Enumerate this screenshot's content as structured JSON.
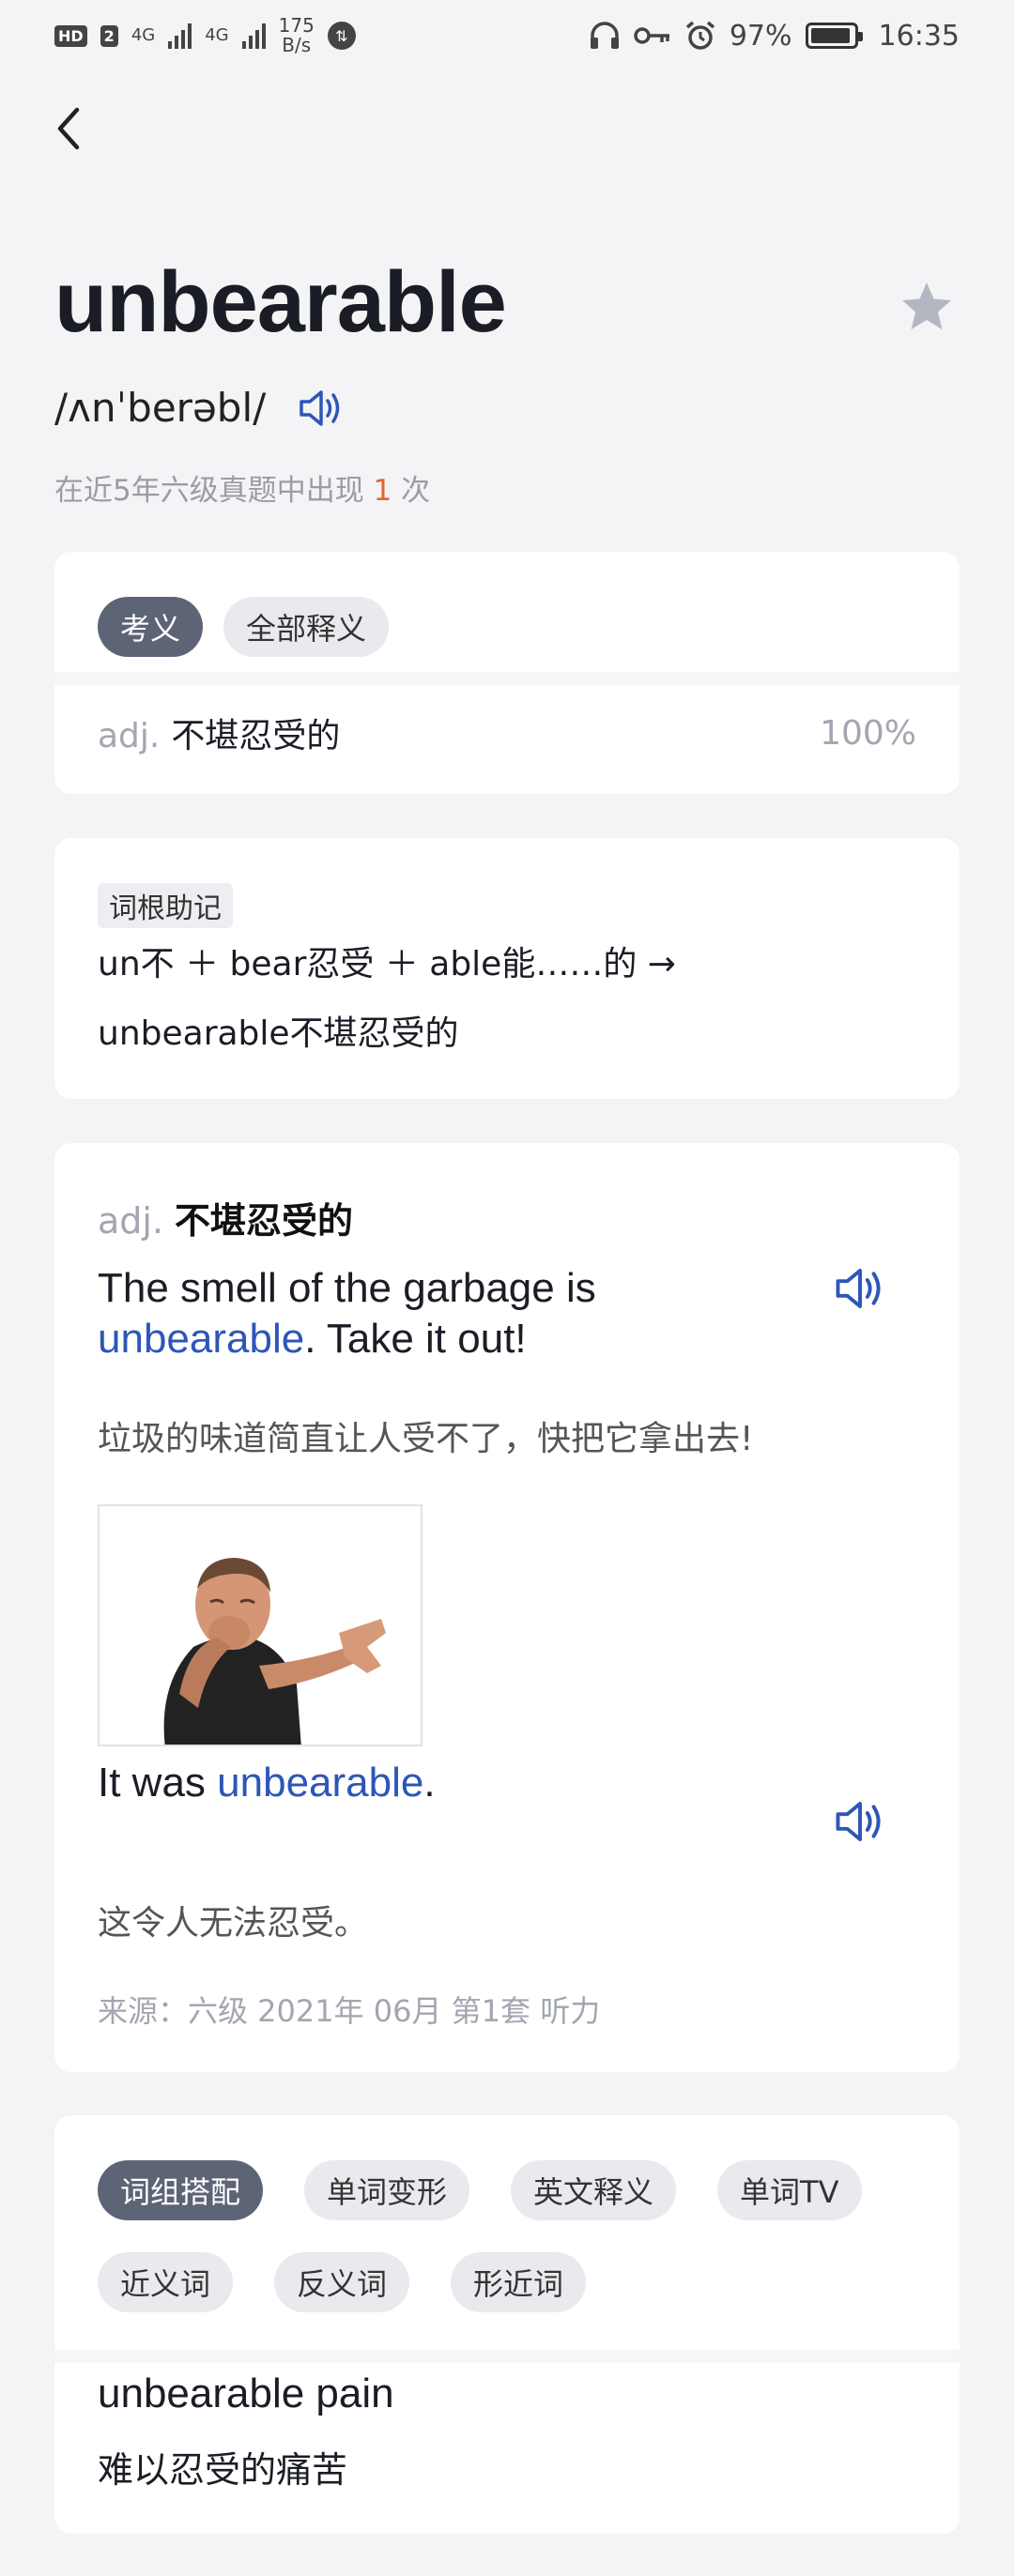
{
  "status_bar": {
    "hd": "HD",
    "sim": "2",
    "net1": "4G",
    "net2": "4G",
    "speed_value": "175",
    "speed_unit": "B/s",
    "battery": "97%",
    "time": "16:35"
  },
  "word": {
    "headword": "unbearable",
    "phonetic": "/ʌnˈberəbl/",
    "frequency_prefix": "在近5年六级真题中出现 ",
    "frequency_count": "1",
    "frequency_suffix": " 次"
  },
  "definition_card": {
    "tabs": [
      {
        "label": "考义",
        "active": true
      },
      {
        "label": "全部释义",
        "active": false
      }
    ],
    "pos": "adj.",
    "meaning": "不堪忍受的",
    "percent": "100%"
  },
  "mnemonic_card": {
    "tag": "词根助记",
    "line1": "un不 ＋ bear忍受 ＋ able能……的 →",
    "line2": "unbearable不堪忍受的"
  },
  "example_card": {
    "pos": "adj.",
    "meaning": "不堪忍受的",
    "sentence1_pre": "The smell of the garbage is ",
    "sentence1_hl": "unbearable",
    "sentence1_post": ". Take it out!",
    "translation1": "垃圾的味道简直让人受不了，快把它拿出去!",
    "sentence2_pre": "It was ",
    "sentence2_hl": "unbearable",
    "sentence2_post": ".",
    "translation2": "这令人无法忍受。",
    "source": "来源：六级 2021年 06月 第1套 听力"
  },
  "phrase_card": {
    "tabs": [
      {
        "label": "词组搭配",
        "active": true
      },
      {
        "label": "单词变形",
        "active": false
      },
      {
        "label": "英文释义",
        "active": false
      },
      {
        "label": "单词TV",
        "active": false
      },
      {
        "label": "近义词",
        "active": false
      },
      {
        "label": "反义词",
        "active": false
      },
      {
        "label": "形近词",
        "active": false
      }
    ],
    "phrase_en": "unbearable pain",
    "phrase_zh": "难以忍受的痛苦"
  },
  "colors": {
    "accent_blue": "#2d56b8",
    "count_orange": "#e5642a",
    "active_pill": "#5d6476"
  }
}
